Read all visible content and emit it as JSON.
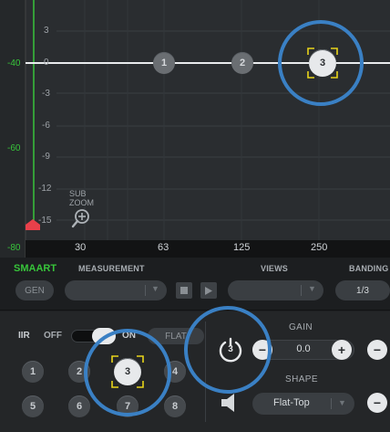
{
  "plot": {
    "y_ticks": [
      "3",
      "0",
      "-3",
      "-6",
      "-9",
      "-12",
      "-15"
    ],
    "left_scale": [
      "-40",
      "-60",
      "-80"
    ],
    "x_ticks": [
      "30",
      "63",
      "125",
      "250"
    ],
    "sub_zoom": [
      "SUB",
      "ZOOM"
    ],
    "nodes": [
      "1",
      "2",
      "3"
    ]
  },
  "smaart": {
    "brand": "SMAART",
    "measurement_label": "MEASUREMENT",
    "views_label": "VIEWS",
    "banding_label": "BANDING",
    "gen_button": "GEN",
    "banding_value": "1/3"
  },
  "filter": {
    "type": "IIR",
    "off_label": "OFF",
    "on_label": "ON",
    "flat_label": "FLAT",
    "bands": [
      "1",
      "2",
      "3",
      "4",
      "5",
      "6",
      "7",
      "8"
    ]
  },
  "gain": {
    "label": "GAIN",
    "value": "0.0",
    "minus": "−",
    "plus": "+"
  },
  "shape": {
    "label": "SHAPE",
    "value": "Flat-Top"
  },
  "power_band": "3",
  "colors": {
    "accent_green": "#37c43a",
    "highlight_ring": "#3a80c4",
    "selection_yellow": "#e8d41a",
    "marker_red": "#e8404a"
  }
}
